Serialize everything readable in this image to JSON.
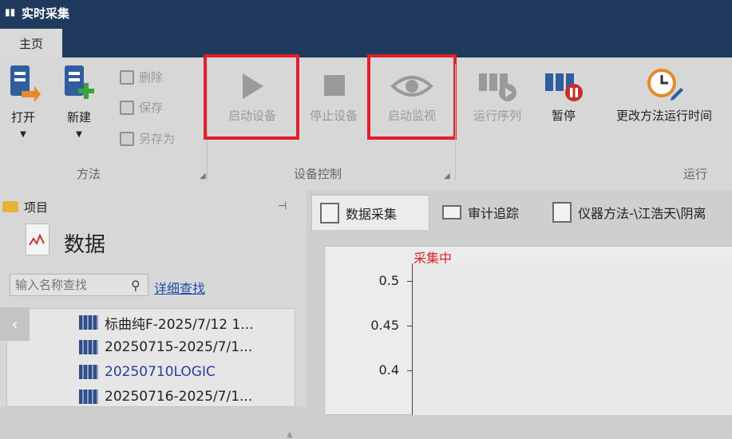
{
  "window": {
    "title": "实时采集"
  },
  "tabs": {
    "home": "主页"
  },
  "ribbon": {
    "method_group": {
      "label": "方法",
      "open": "打开",
      "new": "新建",
      "delete": "删除",
      "save": "保存",
      "save_as": "另存为"
    },
    "device_group": {
      "label": "设备控制",
      "start_device": "启动设备",
      "stop_device": "停止设备",
      "start_monitor": "启动监视"
    },
    "run_group": {
      "label": "运行",
      "run_sequence": "运行序列",
      "pause": "暂停",
      "change_method_run_time": "更改方法运行时间"
    }
  },
  "project_pane": {
    "title": "项目",
    "section_title": "数据",
    "search_placeholder": "输入名称查找",
    "advanced_search": "详细查找",
    "items": [
      {
        "label": "标曲纯F-2025/7/12 1...",
        "highlight": false
      },
      {
        "label": "20250715-2025/7/1...",
        "highlight": false
      },
      {
        "label": "20250710LOGIC",
        "highlight": true
      },
      {
        "label": "20250716-2025/7/1...",
        "highlight": false
      }
    ]
  },
  "doc_tabs": [
    {
      "label": "数据采集"
    },
    {
      "label": "审计追踪"
    },
    {
      "label": "仪器方法-\\江浩天\\阴离"
    }
  ],
  "chart": {
    "status": "采集中",
    "y_ticks": [
      "0.5",
      "0.45",
      "0.4"
    ]
  },
  "colors": {
    "title_bar": "#1f3a5c",
    "highlight_box": "#e0202a",
    "status_text": "#dd2222",
    "link": "#1f4fa8"
  }
}
